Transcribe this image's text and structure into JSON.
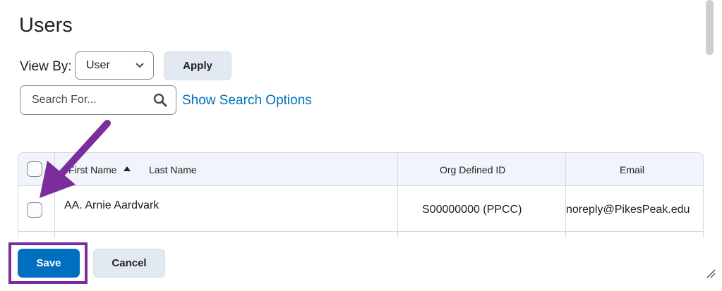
{
  "page": {
    "title": "Users"
  },
  "filter": {
    "view_by_label": "View By:",
    "view_by_selected": "User",
    "apply_label": "Apply"
  },
  "search": {
    "placeholder": "Search For...",
    "options_link": "Show Search Options"
  },
  "table": {
    "headers": {
      "name_first": "First Name",
      "name_last": "Last Name",
      "org_id": "Org Defined ID",
      "email": "Email"
    },
    "rows": [
      {
        "name": "AA. Arnie Aardvark",
        "org_id": "S00000000 (PPCC)",
        "email": "noreply@PikesPeak.edu"
      }
    ]
  },
  "actions": {
    "save_label": "Save",
    "cancel_label": "Cancel"
  },
  "annotations": {
    "color": "#7a2e9c"
  },
  "colors": {
    "link": "#006fbf",
    "primary": "#006fbf",
    "header_bg": "#f1f5fb"
  },
  "icons": {
    "search": "search-icon",
    "chevron": "chevron-down-icon",
    "sort": "sort-ascending-icon",
    "resize": "resize-grip-icon"
  }
}
